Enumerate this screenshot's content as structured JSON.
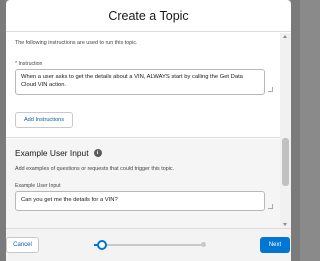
{
  "modal": {
    "title": "Create a Topic"
  },
  "instructions_section": {
    "intro": "The following instructions are used to run this topic.",
    "field_required_marker": "*",
    "field_label": "Instruction",
    "instruction_value": "When a user asks to get the details about a VIN, ALWAYS start by calling the Get Data Cloud VIN action.",
    "add_button_label": "Add Instructions"
  },
  "example_section": {
    "title": "Example User Input",
    "info_icon": "info-icon",
    "description": "Add examples of questions or requests that could trigger this topic.",
    "field_label": "Example User Input",
    "input_value": "Can you get me the details for a VIN?"
  },
  "footer": {
    "cancel_label": "Cancel",
    "next_label": "Next",
    "progress": 0.07
  },
  "colors": {
    "brand": "#0176d3",
    "link": "#0b5cab",
    "required": "#c23934"
  }
}
